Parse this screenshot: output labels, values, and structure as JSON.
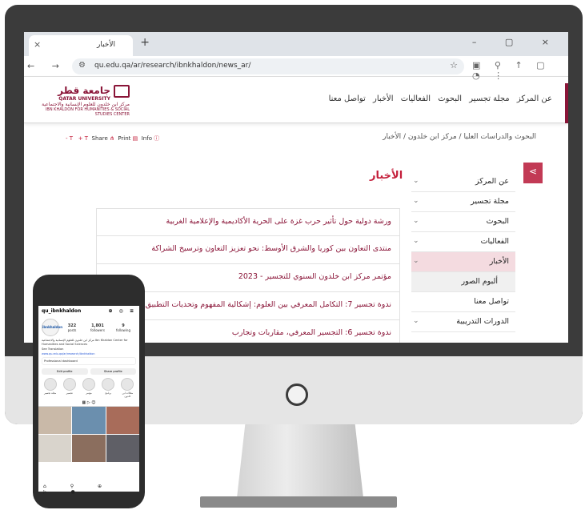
{
  "browser": {
    "tab_title": "الأخبار",
    "tab_close": "×",
    "new_tab": "+",
    "window_controls": "– ▢ ×",
    "nav_buttons": "← → ↻",
    "url": "qu.edu.qa/ar/research/ibnkhaldon/news_ar/",
    "url_icon": "tune-icon",
    "bookmark_icon": "star-icon",
    "extensions": "▣ ⚲ ↑ ▢ ◔ ⋮"
  },
  "site": {
    "logo_ar": "جامعة قطر",
    "logo_en": "QATAR UNIVERSITY",
    "logo_center_ar": "مركز ابن خلدون للعلوم الإنسانية والاجتماعية",
    "logo_center_en": "IBN KHALDON FOR HUMANITIES & SOCIAL STUDIES CENTER",
    "nav": [
      "عن المركز",
      "مجلة تجسير",
      "البحوث",
      "الفعاليات",
      "الأخبار",
      "تواصل معنا"
    ],
    "breadcrumb": "البحوث والدراسات العليا / مركز ابن خلدون / الأخبار",
    "tools": {
      "font_minus": "- T",
      "font_plus": "+ T",
      "share": "Share",
      "print": "Print",
      "info": "Info"
    },
    "page_title": "الأخبار",
    "sidebar": [
      {
        "label": "عن المركز",
        "chev": "⌄"
      },
      {
        "label": "مجلة تجسير",
        "chev": "⌄"
      },
      {
        "label": "البحوث",
        "chev": "⌄"
      },
      {
        "label": "الفعاليات",
        "chev": "⌄"
      },
      {
        "label": "الأخبار",
        "chev": "⌄"
      },
      {
        "label": "ألبوم الصور",
        "chev": ""
      },
      {
        "label": "تواصل معنا",
        "chev": ""
      },
      {
        "label": "الدورات التدريبية",
        "chev": "⌄"
      }
    ],
    "news": [
      "ورشة دولية حول تأثير حرب غزة على الحرية الأكاديمية والإعلامية الغربية",
      "منتدى التعاون بين كوريا والشرق الأوسط: نحو تعزيز التعاون وترسيخ الشراكة",
      "مؤتمر مركز ابن خلدون السنوي للتجسير - 2023",
      "ندوة تجسير 7: التكامل المعرفي بين العلوم: إشكالية المفهوم وتحديات التطبيق",
      "ندوة تجسير 6: التجسير المعرفي، مقاربات وتجارب"
    ],
    "share_icon": "share-icon"
  },
  "phone": {
    "username": "qu_ibnkhaldon",
    "top_icons": "⊕ ◎ ≡",
    "avatar_text": "ibnkhaldon",
    "stats": [
      {
        "num": "322",
        "label": "posts"
      },
      {
        "num": "1,801",
        "label": "followers"
      },
      {
        "num": "9",
        "label": "following"
      }
    ],
    "bio": "مركز ابن خلدون للعلوم الإنسانية والاجتماعية Ibn Khaldon Center for Humanities and Social Sciences",
    "see_translation": "See Translation",
    "link": "www.qu.edu.qa/ar/research/ibnkhaldon",
    "dashboard": "Professional dashboard",
    "buttons": [
      "Edit profile",
      "Share profile"
    ],
    "highlights": [
      "مجلة تجسير",
      "تجسير",
      "مؤتمر",
      "برنامج",
      "مقالات ابن خلدون"
    ],
    "tabs": "▦ ▷ ☺",
    "bottom_bar": "⌂ ⚲ ⊕ ▷ ●"
  }
}
